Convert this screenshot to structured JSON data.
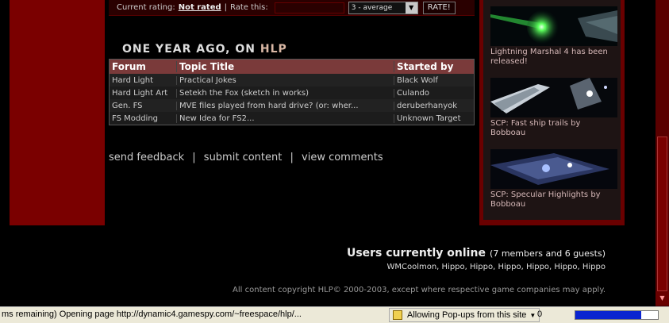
{
  "rating": {
    "current_label": "Current rating:",
    "current_value": "Not rated",
    "separator": "|",
    "rate_label": "Rate this:",
    "select_value": "3 - average",
    "rate_button": "RATE!"
  },
  "one_year_ago": {
    "title_prefix": "ONE YEAR AGO, ON",
    "title_site": "HLP",
    "columns": [
      "Forum",
      "Topic Title",
      "Started by"
    ],
    "rows": [
      {
        "forum": "Hard Light",
        "topic": "Practical Jokes",
        "starter": "Black Wolf"
      },
      {
        "forum": "Hard Light Art",
        "topic": "Setekh the Fox (sketch in works)",
        "starter": "Culando"
      },
      {
        "forum": "Gen. FS",
        "topic": "MVE files played from hard drive? (or: wher...",
        "starter": "deruberhanyok"
      },
      {
        "forum": "FS Modding",
        "topic": "New Idea for FS2...",
        "starter": "Unknown Target"
      }
    ]
  },
  "footer_links": {
    "feedback": "send feedback",
    "submit": "submit content",
    "comments": "view comments",
    "sep": "|"
  },
  "news": [
    {
      "caption": "Lightning Marshal 4 has been released!"
    },
    {
      "caption": "SCP: Fast ship trails by Bobboau"
    },
    {
      "caption": "SCP: Specular Highlights by Bobboau"
    }
  ],
  "online": {
    "title": "Users currently online",
    "count": "(7 members and 6 guests)",
    "names": "WMCoolmon, Hippo, Hippo, Hippo, Hippo, Hippo, Hippo"
  },
  "copyright": "All content copyright HLP© 2000-2003, except where respective game companies may apply.",
  "statusbar": {
    "text": "ms remaining) Opening page http://dynamic4.gamespy.com/~freespace/hlp/...",
    "popup": "Allowing Pop-ups from this site",
    "zero": "0",
    "progress_fraction": 0.8
  },
  "colors": {
    "dark_red": "#7a0000",
    "table_header": "#7a3a3a",
    "progress_fill": "#0a24d0"
  }
}
